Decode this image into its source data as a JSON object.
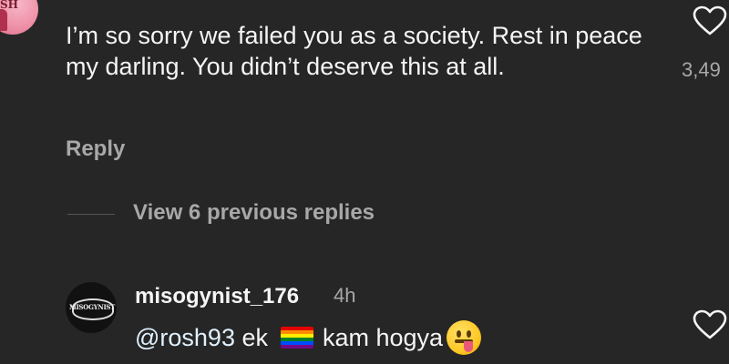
{
  "top_comment": {
    "avatar_text": "SH",
    "text": "I’m so sorry we failed you as a society. Rest in peace my darling. You didn’t deserve this at all.",
    "reply_label": "Reply",
    "like_count": "3,49",
    "like_icon": "heart-outline-icon"
  },
  "thread": {
    "view_replies_label": "View 6 previous replies"
  },
  "reply_comment": {
    "avatar_text": "MISOGYNIST",
    "username": "misogynist_176",
    "time": "4h",
    "mention": "@rosh93",
    "text_before_flag": " ek",
    "text_after_flag": "kam hogya",
    "flag_icon": "rainbow-flag-icon",
    "emoji_icon": "tongue-out-face-icon",
    "like_icon": "heart-outline-icon"
  },
  "colors": {
    "background": "#262626",
    "text_primary": "#f5f5f5",
    "text_secondary": "#a8a8a8",
    "verified": "#3897f0"
  }
}
